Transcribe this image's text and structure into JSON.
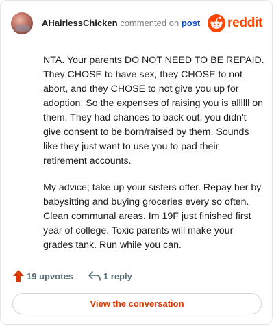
{
  "header": {
    "username": "AHairlessChicken",
    "action_text": "commented on",
    "post_link": "post",
    "brand_word": "reddit",
    "brand_color": "#ff4500"
  },
  "comment": {
    "paragraphs": [
      "NTA. Your parents DO NOT NEED TO BE REPAID. They CHOSE to have sex, they CHOSE to not abort, and they CHOSE to not give you up for adoption. So the expenses of raising you is allllll on them. They had chances to back out, you didn't give consent to be born/raised by them. Sounds like they just want to use you to pad their retirement accounts.",
      "My advice; take up your sisters offer. Repay her by babysitting and buying groceries every so often. Clean communal areas. Im 19F just finished first year of college. Toxic parents will make your grades tank. Run while you can."
    ]
  },
  "footer": {
    "upvotes": "19 upvotes",
    "replies": "1 reply",
    "view_button": "View the conversation",
    "upvote_icon": "arrow-up-icon",
    "reply_icon": "reply-arrow-icon",
    "accent_color": "#d93900"
  }
}
